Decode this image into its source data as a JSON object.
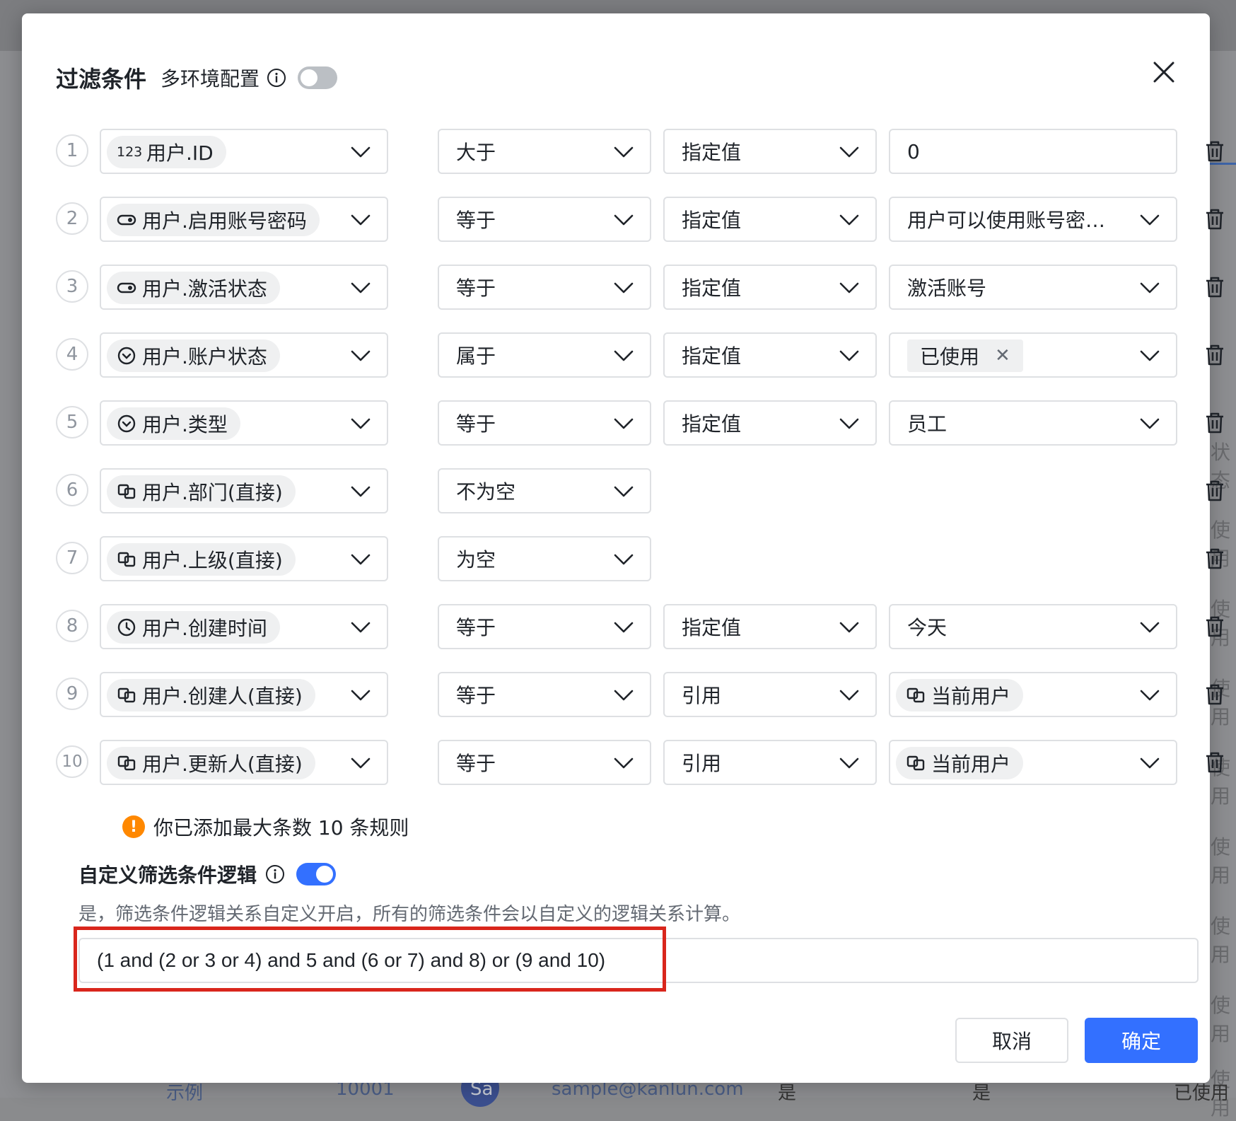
{
  "background": {
    "side_texts": [
      "状态",
      "使用",
      "使用",
      "使用",
      "使用",
      "使用",
      "使用",
      "使用",
      "使用"
    ],
    "footer": [
      "示例",
      "10001",
      "Sa",
      "sample@kanlun.com",
      "是",
      "是",
      "已使用"
    ]
  },
  "dialog": {
    "title": "过滤条件",
    "subtitle": "多环境配置",
    "multi_env_enabled": false
  },
  "rows": [
    {
      "num": "1",
      "field": "用户.ID",
      "field_icon": "number-123-icon",
      "field_icon_text": "123",
      "op": "大于",
      "kind": "指定值",
      "value": "0",
      "value_type": "input"
    },
    {
      "num": "2",
      "field": "用户.启用账号密码",
      "field_icon": "toggle-icon",
      "op": "等于",
      "kind": "指定值",
      "value": "用户可以使用账号密码...",
      "value_type": "select"
    },
    {
      "num": "3",
      "field": "用户.激活状态",
      "field_icon": "toggle-icon",
      "op": "等于",
      "kind": "指定值",
      "value": "激活账号",
      "value_type": "select"
    },
    {
      "num": "4",
      "field": "用户.账户状态",
      "field_icon": "circle-check-icon",
      "op": "属于",
      "kind": "指定值",
      "value": "已使用",
      "value_type": "multi"
    },
    {
      "num": "5",
      "field": "用户.类型",
      "field_icon": "circle-check-icon",
      "op": "等于",
      "kind": "指定值",
      "value": "员工",
      "value_type": "select"
    },
    {
      "num": "6",
      "field": "用户.部门(直接)",
      "field_icon": "link-icon",
      "op": "不为空",
      "kind": "",
      "value": "",
      "value_type": "none"
    },
    {
      "num": "7",
      "field": "用户.上级(直接)",
      "field_icon": "link-icon",
      "op": "为空",
      "kind": "",
      "value": "",
      "value_type": "none"
    },
    {
      "num": "8",
      "field": "用户.创建时间",
      "field_icon": "clock-icon",
      "op": "等于",
      "kind": "指定值",
      "value": "今天",
      "value_type": "select"
    },
    {
      "num": "9",
      "field": "用户.创建人(直接)",
      "field_icon": "link-icon",
      "op": "等于",
      "kind": "引用",
      "value": "当前用户",
      "value_type": "ref"
    },
    {
      "num": "10",
      "field": "用户.更新人(直接)",
      "field_icon": "link-icon",
      "op": "等于",
      "kind": "引用",
      "value": "当前用户",
      "value_type": "ref"
    }
  ],
  "warning": "你已添加最大条数 10 条规则",
  "custom_logic": {
    "label": "自定义筛选条件逻辑",
    "enabled": true,
    "description": "是，筛选条件逻辑关系自定义开启，所有的筛选条件会以自定义的逻辑关系计算。",
    "expression": "(1 and (2 or 3 or 4) and 5 and (6 or 7) and 8) or (9 and 10)"
  },
  "buttons": {
    "cancel": "取消",
    "ok": "确定"
  },
  "colors": {
    "primary": "#3370ff",
    "warning": "#ff8800",
    "highlight": "#d9261c",
    "border": "#dee0e3"
  }
}
